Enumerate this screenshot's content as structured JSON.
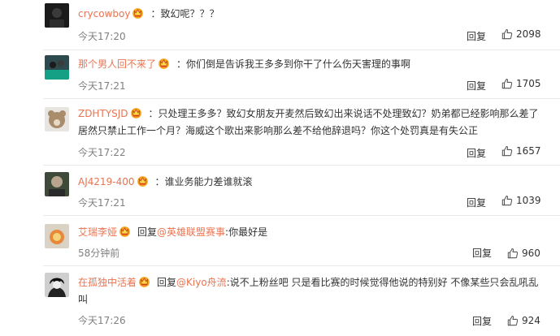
{
  "labels": {
    "reply": "回复",
    "reply_prefix": "回复",
    "colon": ":"
  },
  "comments": [
    {
      "username": "crycowboy",
      "text": "：致幻呢？？？",
      "time": "今天17:20",
      "likes": "2098"
    },
    {
      "username": "那个男人回不来了",
      "text": "：你们倒是告诉我王多多到你干了什么伤天害理的事啊",
      "time": "今天17:21",
      "likes": "1705"
    },
    {
      "username": "ZDHTYSJD",
      "text": "：只处理王多多？致幻女朋友开麦然后致幻出来说话不处理致幻？奶弟都已经影响那么差了居然只禁止工作一个月？海威这个歌出来影响那么差不给他辞退吗？你这个处罚真是有失公正",
      "time": "今天17:22",
      "likes": "1657"
    },
    {
      "username": "AJ4219-400",
      "text": "：谁业务能力差谁就滚",
      "time": "今天17:21",
      "likes": "1039"
    },
    {
      "username": "艾瑞李娅",
      "reply_target": "@英雄联盟赛事",
      "text": ":你最好是",
      "time": "58分钟前",
      "likes": "960"
    },
    {
      "username": "在孤独中活着",
      "reply_target": "@Kiyo舟流",
      "text": ":说不上粉丝吧 只是看比赛的时候觉得他说的特别好 不像某些只会乱吼乱叫",
      "time": "今天17:26",
      "likes": "924"
    }
  ],
  "colors": {
    "username": "#eb7350",
    "crown": "#f4b400",
    "separator": "#eaeaea"
  }
}
